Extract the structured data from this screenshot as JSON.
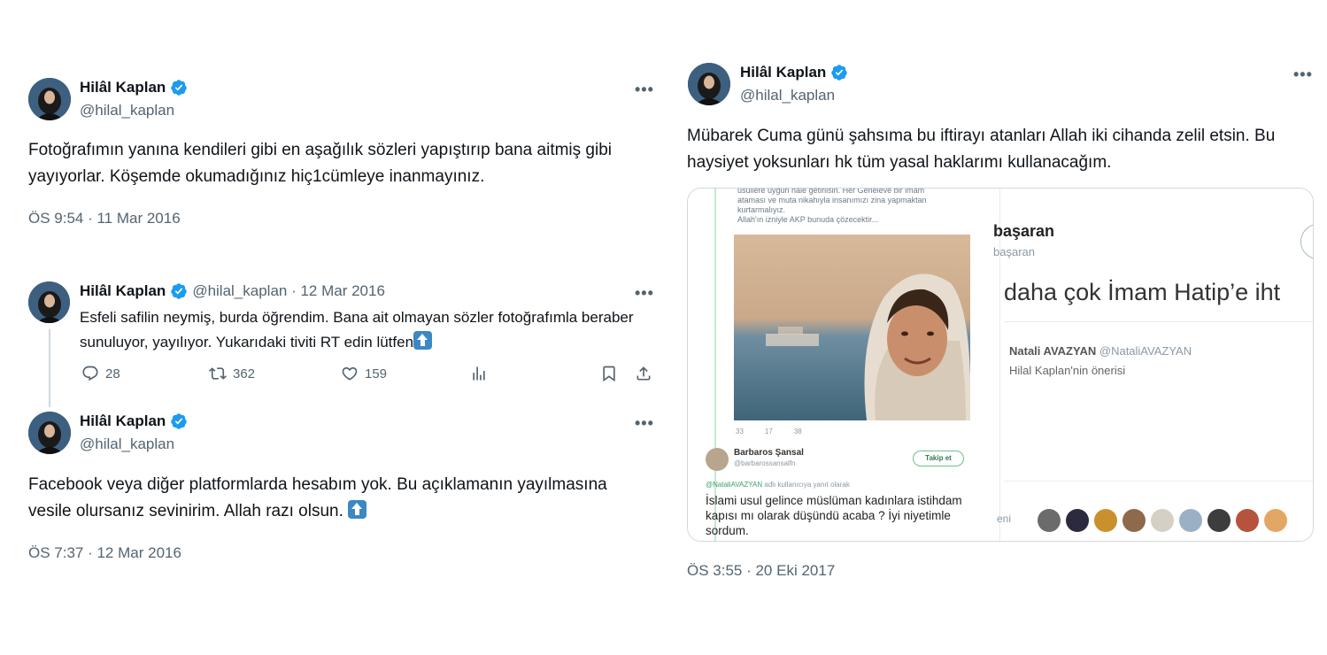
{
  "tweet1": {
    "name": "Hilâl Kaplan",
    "handle": "@hilal_kaplan",
    "more": "•••",
    "text": "Fotoğrafımın yanına kendileri gibi en aşağılık sözleri yapıştırıp bana aitmiş gibi yayıyorlar. Köşemde okumadığınız hiç1cümleye inanmayınız.",
    "timestamp": "ÖS 9:54 · 11 Mar 2016"
  },
  "tweet2": {
    "name": "Hilâl Kaplan",
    "handle_date": "@hilal_kaplan · 12 Mar 2016",
    "more": "•••",
    "text": "Esfeli safilin neymiş, burda öğrendim. Bana ait olmayan sözler fotoğrafımla beraber sunuluyor, yayılıyor. Yukarıdaki tiviti RT edin lütfen",
    "actions": {
      "replies": "28",
      "retweets": "362",
      "likes": "159"
    }
  },
  "tweet3": {
    "name": "Hilâl Kaplan",
    "handle": "@hilal_kaplan",
    "more": "•••",
    "text": "Facebook veya diğer platformlarda hesabım yok. Bu açıklamanın yayılmasına vesile olursanız sevinirim. Allah razı olsun.",
    "timestamp": "ÖS 7:37 · 12 Mar 2016"
  },
  "tweet4": {
    "name": "Hilâl Kaplan",
    "handle": "@hilal_kaplan",
    "more": "•••",
    "text": "Mübarek Cuma günü şahsıma bu iftirayı atanları Allah iki cihanda zelil etsin. Bu haysiyet yoksunları hk tüm yasal haklarımı kullanacağım.",
    "timestamp": "ÖS 3:55 · 20 Eki 2017",
    "media": {
      "left": {
        "top_lines": [
          "usullere uygun hale getirilsin. Her Geneleve bir imam",
          "ataması ve muta nikahıyla insanımızı zina yapmaktan",
          "kurtarmalıyız.",
          "Allah'ın izniyle AKP bunuda çözecektir..."
        ],
        "mini_actions": [
          "33",
          "17",
          "38",
          ""
        ],
        "author_name": "Barbaros Şansal",
        "author_handle": "@barbarossansalfn",
        "follow_label": "Takip et",
        "reply_to_handle": "@NataliAVAZYAN",
        "reply_to_rest": " adlı kullanıcıya yanıt olarak",
        "reply_text": "İslami usul gelince müslüman kadınlara istihdam kapısı mı olarak düşündü acaba ? İyi niyetimle sordum."
      },
      "right": {
        "name": "başaran",
        "handle": "başaran",
        "big_text": "daha çok İmam Hatip’e iht",
        "quote_name": "Natali AVAZYAN",
        "quote_handle": "@NataliAVAZYAN",
        "quote_sub": "Hilal Kaplan'nin önerisi",
        "footer_text": "eni"
      }
    }
  },
  "colors": {
    "text": "#0f1419",
    "secondary": "#536471",
    "verified": "#1d9bf0",
    "border": "#cfd9de",
    "arrow_emoji": "#3b88c3"
  },
  "icons": [
    "verified-badge-icon",
    "more-icon",
    "reply-icon",
    "retweet-icon",
    "like-icon",
    "views-icon",
    "bookmark-icon",
    "share-icon",
    "up-arrow-emoji-icon"
  ]
}
